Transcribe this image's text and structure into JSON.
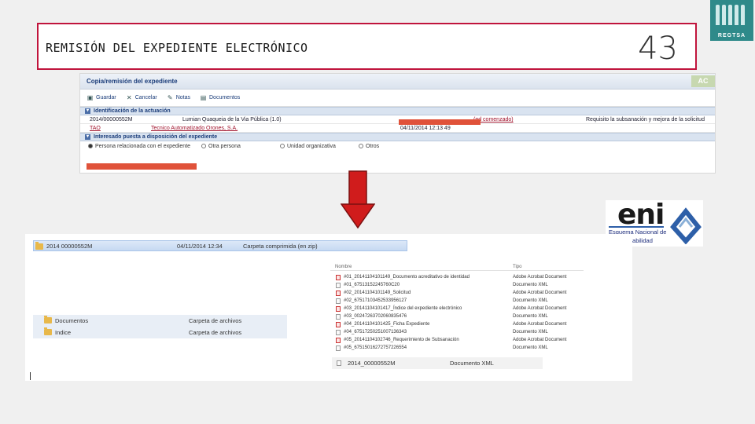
{
  "slide": {
    "title": "REMISIÓN DEL EXPEDIENTE ELECTRÓNICO",
    "number": "43",
    "logo_text": "REGTSA"
  },
  "form": {
    "title": "Copia/remisión del expediente",
    "badge": "AC",
    "toolbar": [
      "Guardar",
      "Cancelar",
      "Notas",
      "Documentos"
    ],
    "section1": "Identificación de la actuación",
    "row1": {
      "expediente": "2014/00000552M",
      "descripcion": "Lumian Quaqueia de la Via Pública (1.0)",
      "estado": "(pd comenzado)",
      "requisito": "Requisito la subsanación y mejora de la solicitud"
    },
    "row2": {
      "codigo": "TAO",
      "tecnico": "Tecnico Automatizado Orones, S.A.",
      "fecha": "04/11/2014 12:13 49"
    },
    "section2": "Interesado puesta a disposición del expediente",
    "options": [
      "Persona relacionada con el expediente",
      "Otra persona",
      "Unidad organizativa",
      "Otros"
    ]
  },
  "eni": {
    "word": "eni",
    "line1": "Esquema Nacional de",
    "line2": "Interoperabilidad"
  },
  "explorer": {
    "zip": {
      "name": "2014 00000552M",
      "date": "04/11/2014 12:34",
      "type": "Carpeta comprimida (en zip)"
    },
    "folders": [
      {
        "name": "Documentos",
        "type": "Carpeta de archivos"
      },
      {
        "name": "Indice",
        "type": "Carpeta de archivos"
      }
    ],
    "columns": {
      "name": "Nombre",
      "type": "Tipo"
    },
    "files": [
      {
        "name": "#01_20141104101149_Documento acreditativo de identidad",
        "type": "Adobe Acrobat Document",
        "icon": "pdf"
      },
      {
        "name": "#01_67513152245760C20",
        "type": "Documento XML",
        "icon": "xml"
      },
      {
        "name": "#02_20141104101149_Solicitud",
        "type": "Adobe Acrobat Document",
        "icon": "pdf"
      },
      {
        "name": "#02_67517103452533956127",
        "type": "Documento XML",
        "icon": "xml"
      },
      {
        "name": "#03_20141104101417_Índice del expediente electrónico",
        "type": "Adobe Acrobat Document",
        "icon": "pdf"
      },
      {
        "name": "#03_00247263702060835476",
        "type": "Documento XML",
        "icon": "xml"
      },
      {
        "name": "#04_20141104101425_Ficha Expediente",
        "type": "Adobe Acrobat Document",
        "icon": "pdf"
      },
      {
        "name": "#04_67517250251007136343",
        "type": "Documento XML",
        "icon": "xml"
      },
      {
        "name": "#05_20141104102746_Requerimiento de Subsanación",
        "type": "Adobe Acrobat Document",
        "icon": "pdf"
      },
      {
        "name": "#05_67515016272757226554",
        "type": "Documento XML",
        "icon": "xml"
      }
    ],
    "xml_file": {
      "name": "2014_00000552M",
      "type": "Documento XML"
    }
  }
}
